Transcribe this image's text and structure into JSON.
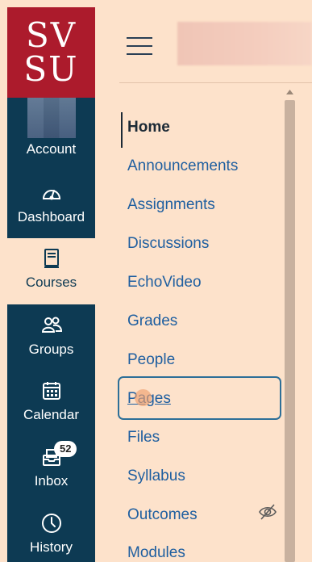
{
  "logo": {
    "line1": "SV",
    "line2": "SU"
  },
  "global_nav": {
    "account": "Account",
    "dashboard": "Dashboard",
    "courses": "Courses",
    "groups": "Groups",
    "calendar": "Calendar",
    "inbox": "Inbox",
    "inbox_badge": "52",
    "history": "History"
  },
  "course_nav": {
    "items": [
      "Home",
      "Announcements",
      "Assignments",
      "Discussions",
      "EchoVideo",
      "Grades",
      "People",
      "Pages",
      "Files",
      "Syllabus",
      "Outcomes",
      "Modules"
    ],
    "active": "Home",
    "focused": "Pages",
    "hidden_items": [
      "Outcomes"
    ]
  },
  "colors": {
    "brand_red": "#ac1b2c",
    "nav_navy": "#0d3a53",
    "link_blue": "#1f5fa0",
    "background": "#fde2cb"
  },
  "icons": [
    "hamburger-icon",
    "dashboard-icon",
    "courses-icon",
    "groups-icon",
    "calendar-icon",
    "inbox-icon",
    "history-icon",
    "eye-off-icon",
    "scroll-up-icon"
  ]
}
